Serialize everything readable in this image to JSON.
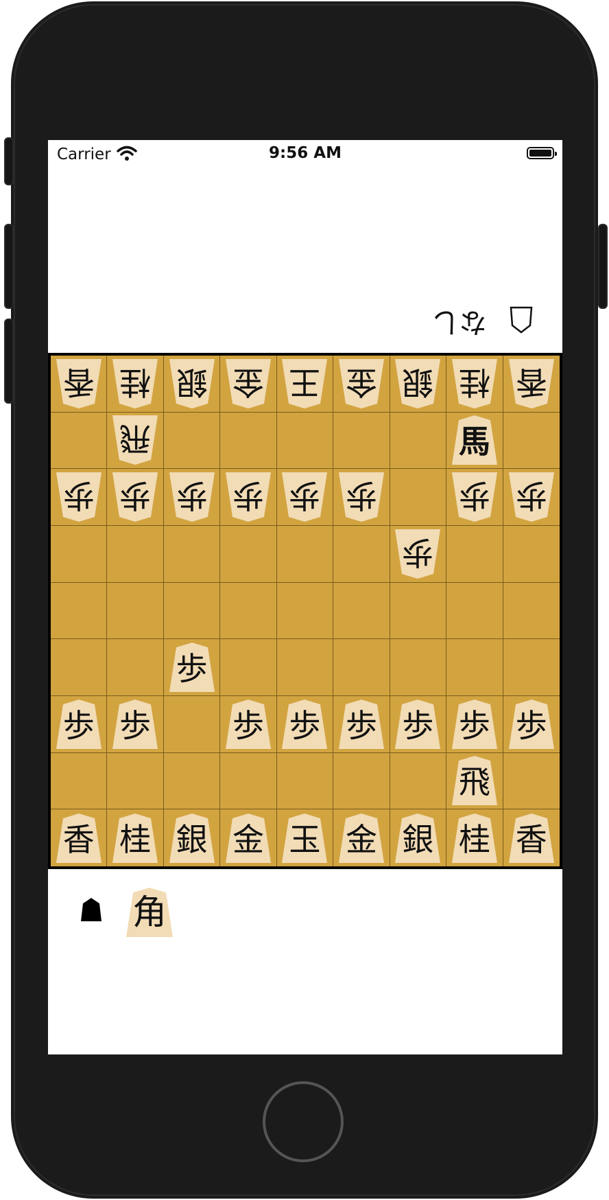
{
  "status_bar": {
    "carrier": "Carrier",
    "time": "9:56 AM"
  },
  "opponent_hand": {
    "label": "なし",
    "mark_icon": "gote-turn-marker-icon (outlined pentagon)"
  },
  "own_hand": {
    "mark_icon": "sente-turn-marker-icon (filled pentagon)",
    "pieces": [
      "角"
    ]
  },
  "colors": {
    "board": "#d2a440",
    "piece_face": "#f2dcb6",
    "grid_line": "#7a5a1a"
  },
  "board": {
    "rows": [
      [
        {
          "c": "香",
          "o": "g"
        },
        {
          "c": "桂",
          "o": "g"
        },
        {
          "c": "銀",
          "o": "g"
        },
        {
          "c": "金",
          "o": "g"
        },
        {
          "c": "王",
          "o": "g"
        },
        {
          "c": "金",
          "o": "g"
        },
        {
          "c": "銀",
          "o": "g"
        },
        {
          "c": "桂",
          "o": "g"
        },
        {
          "c": "香",
          "o": "g"
        }
      ],
      [
        null,
        {
          "c": "飛",
          "o": "g"
        },
        null,
        null,
        null,
        null,
        null,
        {
          "c": "馬",
          "o": "s",
          "p": true
        },
        null
      ],
      [
        {
          "c": "歩",
          "o": "g"
        },
        {
          "c": "歩",
          "o": "g"
        },
        {
          "c": "歩",
          "o": "g"
        },
        {
          "c": "歩",
          "o": "g"
        },
        {
          "c": "歩",
          "o": "g"
        },
        {
          "c": "歩",
          "o": "g"
        },
        null,
        {
          "c": "歩",
          "o": "g"
        },
        {
          "c": "歩",
          "o": "g"
        }
      ],
      [
        null,
        null,
        null,
        null,
        null,
        null,
        {
          "c": "歩",
          "o": "g"
        },
        null,
        null
      ],
      [
        null,
        null,
        null,
        null,
        null,
        null,
        null,
        null,
        null
      ],
      [
        null,
        null,
        {
          "c": "歩",
          "o": "s"
        },
        null,
        null,
        null,
        null,
        null,
        null
      ],
      [
        {
          "c": "歩",
          "o": "s"
        },
        {
          "c": "歩",
          "o": "s"
        },
        null,
        {
          "c": "歩",
          "o": "s"
        },
        {
          "c": "歩",
          "o": "s"
        },
        {
          "c": "歩",
          "o": "s"
        },
        {
          "c": "歩",
          "o": "s"
        },
        {
          "c": "歩",
          "o": "s"
        },
        {
          "c": "歩",
          "o": "s"
        }
      ],
      [
        null,
        null,
        null,
        null,
        null,
        null,
        null,
        {
          "c": "飛",
          "o": "s"
        },
        null
      ],
      [
        {
          "c": "香",
          "o": "s"
        },
        {
          "c": "桂",
          "o": "s"
        },
        {
          "c": "銀",
          "o": "s"
        },
        {
          "c": "金",
          "o": "s"
        },
        {
          "c": "玉",
          "o": "s"
        },
        {
          "c": "金",
          "o": "s"
        },
        {
          "c": "銀",
          "o": "s"
        },
        {
          "c": "桂",
          "o": "s"
        },
        {
          "c": "香",
          "o": "s"
        }
      ]
    ]
  }
}
